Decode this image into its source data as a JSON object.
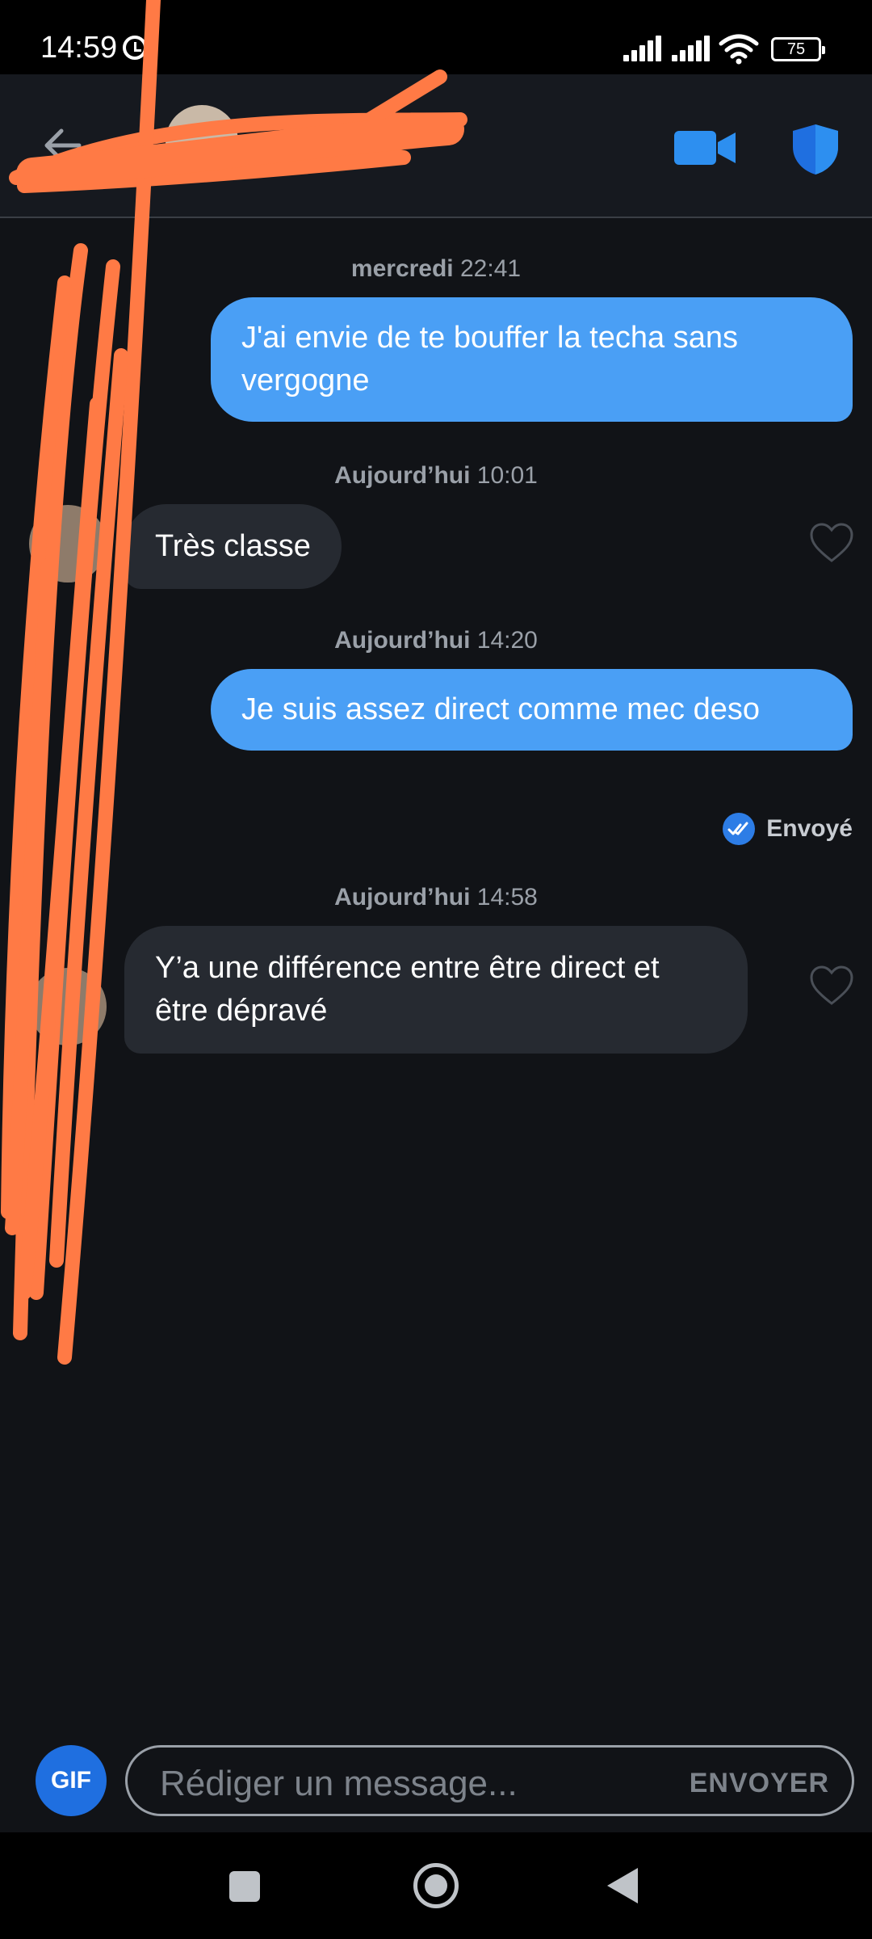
{
  "status_bar": {
    "time": "14:59",
    "battery": "75",
    "icons": [
      "alarm-icon",
      "signal-icon",
      "signal-icon",
      "wifi-icon",
      "battery-icon"
    ]
  },
  "header": {
    "icons": [
      "back-arrow-icon",
      "video-camera-icon",
      "shield-icon"
    ],
    "accent_color": "#2d8ff0"
  },
  "messages": [
    {
      "type": "timestamp",
      "day": "mercredi",
      "time": "22:41"
    },
    {
      "type": "outgoing",
      "text": "J'ai envie de te bouffer la techa sans vergogne"
    },
    {
      "type": "timestamp",
      "day": "Aujourd’hui",
      "time": "10:01"
    },
    {
      "type": "incoming",
      "text": "Très classe"
    },
    {
      "type": "timestamp",
      "day": "Aujourd’hui",
      "time": "14:20"
    },
    {
      "type": "outgoing",
      "text": "Je suis assez direct comme mec deso",
      "status": "Envoyé"
    },
    {
      "type": "timestamp",
      "day": "Aujourd’hui",
      "time": "14:58"
    },
    {
      "type": "incoming",
      "text": "Y’a une différence entre être direct et être dépravé"
    }
  ],
  "composer": {
    "gif_label": "GIF",
    "placeholder": "Rédiger un message...",
    "send_label": "ENVOYER"
  },
  "colors": {
    "outgoing_bubble": "#4a9ff5",
    "incoming_bubble": "#262a31",
    "background": "#111317",
    "redaction": "#ff7a45"
  }
}
